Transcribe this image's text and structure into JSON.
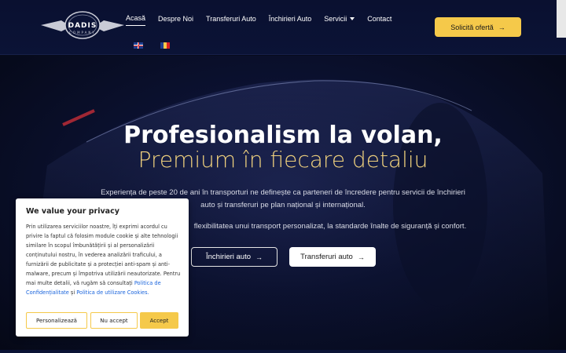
{
  "logo": {
    "name": "DADIS",
    "tagline": "COMPANY"
  },
  "nav": {
    "items": [
      {
        "label": "Acasă"
      },
      {
        "label": "Despre Noi"
      },
      {
        "label": "Transferuri Auto"
      },
      {
        "label": "Închirieri Auto"
      },
      {
        "label": "Servicii"
      },
      {
        "label": "Contact"
      }
    ]
  },
  "header": {
    "cta_label": "Solicită ofertă",
    "arrow": "→"
  },
  "hero": {
    "title": "Profesionalism la volan,",
    "subtitle": "Premium în fiecare detaliu",
    "description_1": "Experiența de peste 20 de ani în transporturi ne definește ca parteneri de încredere pentru servicii de închirieri auto și transferuri pe plan național și internațional.",
    "description_2": "flexibilitatea unui transport personalizat, la standarde înalte de siguranță și confort.",
    "btn_rent": "Închirieri auto",
    "btn_transfer": "Transferuri auto",
    "arrow": "→"
  },
  "cookie": {
    "title": "We value your privacy",
    "text_1": "Prin utilizarea serviciilor noastre, îți exprimi acordul cu privire la faptul că folosim module cookie și alte tehnologii similare în scopul îmbunătățirii și al personalizării conținutului nostru, în vederea analizării traficului, a furnizării de publicitate și a protecției anti-spam și anti-malware, precum și împotriva utilizării neautorizate. Pentru mai multe detalii, vă rugăm să consultați",
    "link_privacy": "Politica de Confidențialitate",
    "and": "și",
    "link_cookies": "Politica de utilizare Cookies.",
    "btn_customize": "Personalizează",
    "btn_reject": "Nu accept",
    "btn_accept": "Accept"
  },
  "colors": {
    "accent": "#f5c94a",
    "navy": "#0b1336",
    "gold_text": "#f1d27e",
    "link": "#1863dc"
  }
}
